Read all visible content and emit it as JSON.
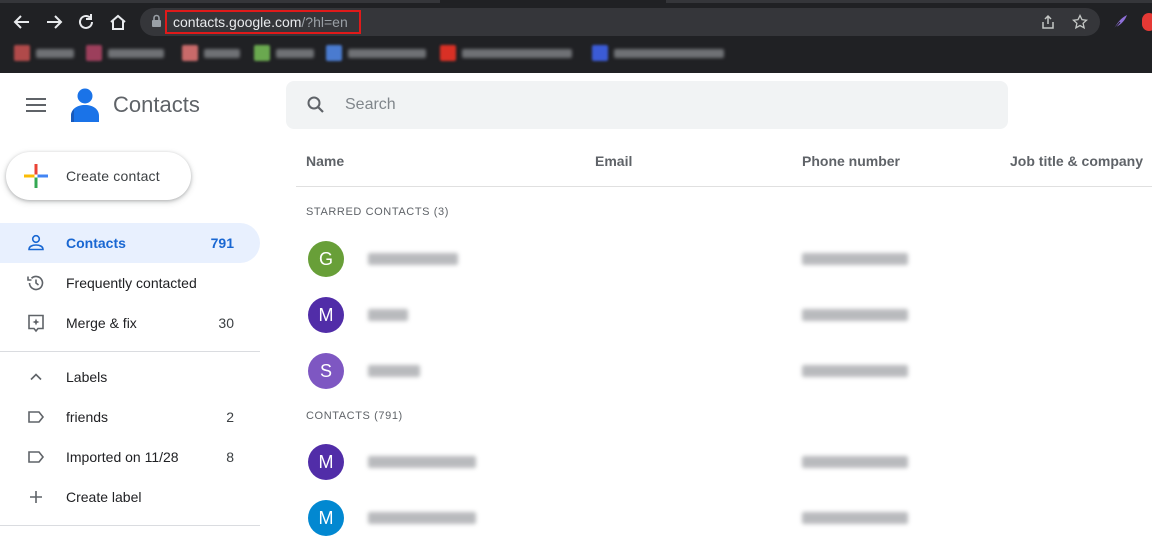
{
  "browser": {
    "url_domain": "contacts.google.com",
    "url_rest": "/?hl=en",
    "bookmarks": [
      {
        "icon_color": "#b04a4a"
      },
      {
        "icon_color": "#9c3f5c"
      },
      {
        "icon_color": "#c96a6a"
      },
      {
        "icon_color": "#6aa84f"
      },
      {
        "icon_color": "#4a7bd0"
      },
      {
        "icon_color": "#d93025"
      },
      {
        "icon_color": "#3b5bd6"
      }
    ]
  },
  "app": {
    "title": "Contacts",
    "search_placeholder": "Search",
    "create_label": "Create contact"
  },
  "sidebar": {
    "items": [
      {
        "label": "Contacts",
        "count": "791",
        "icon": "person-icon",
        "active": true
      },
      {
        "label": "Frequently contacted",
        "count": "",
        "icon": "history-icon",
        "active": false
      },
      {
        "label": "Merge & fix",
        "count": "30",
        "icon": "merge-fix-icon",
        "active": false
      }
    ],
    "labels_header": "Labels",
    "labels": [
      {
        "label": "friends",
        "count": "2",
        "icon": "label-icon"
      },
      {
        "label": "Imported on 11/28",
        "count": "8",
        "icon": "label-icon"
      }
    ],
    "create_label": "Create label"
  },
  "table": {
    "columns": [
      "Name",
      "Email",
      "Phone number",
      "Job title & company"
    ],
    "starred_title": "STARRED CONTACTS (3)",
    "contacts_title": "CONTACTS (791)",
    "starred": [
      {
        "initial": "G",
        "color": "#689f38"
      },
      {
        "initial": "M",
        "color": "#512da8"
      },
      {
        "initial": "S",
        "color": "#7e57c2"
      }
    ],
    "contacts": [
      {
        "initial": "M",
        "color": "#512da8"
      },
      {
        "initial": "M",
        "color": "#0288d1"
      }
    ]
  },
  "colors": {
    "accent": "#1967d2",
    "active_bg": "#e8f0fe",
    "url_highlight": "#e01a1a"
  }
}
